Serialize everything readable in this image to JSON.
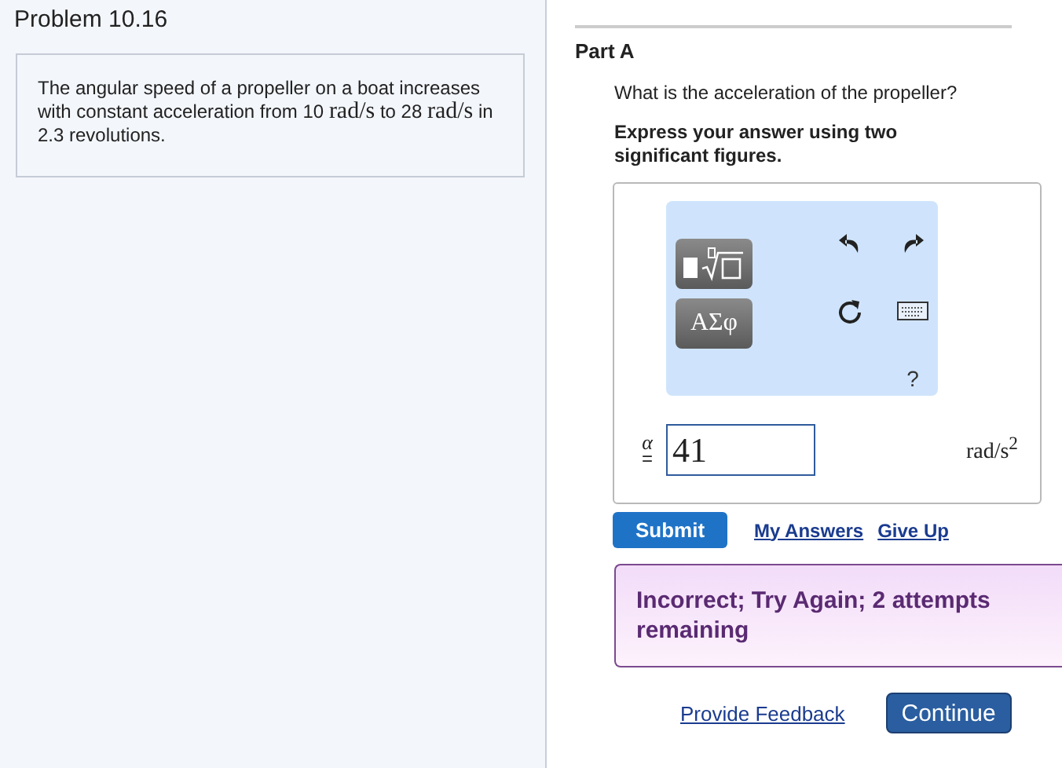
{
  "problem": {
    "title": "Problem 10.16",
    "statement": [
      {
        "kind": "text",
        "text": "The angular speed of a propeller on a boat increases with constant acceleration from 10 "
      },
      {
        "kind": "unit",
        "text": "rad/s"
      },
      {
        "kind": "text",
        "text": " to 28 "
      },
      {
        "kind": "unit",
        "text": "rad/s"
      },
      {
        "kind": "text",
        "text": " in 2.3 revolutions."
      }
    ]
  },
  "part": {
    "label": "Part A",
    "question": "What is the acceleration of the propeller?",
    "instruction": "Express your answer using two significant figures.",
    "toolbar": {
      "symbols": "ΑΣφ",
      "help": "?"
    },
    "answer": {
      "variable": "α",
      "equals": "=",
      "value": "41",
      "unit": "rad/s$^{2}$"
    },
    "submit": "Submit",
    "links": [
      "My Answers",
      "Give Up"
    ],
    "feedback": "Incorrect; Try Again; 2 attempts remaining"
  },
  "footer": {
    "feedback_link": "Provide Feedback",
    "continue": "Continue"
  }
}
